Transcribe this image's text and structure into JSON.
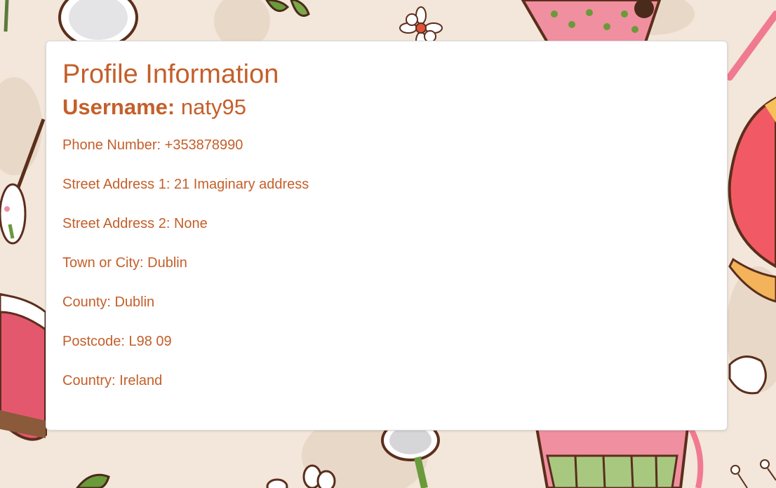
{
  "profile": {
    "title": "Profile Information",
    "username_label": "Username:",
    "username_value": "naty95",
    "fields": [
      "Phone Number: +353878990",
      "Street Address 1: 21 Imaginary address",
      "Street Address 2: None",
      "Town or City: Dublin",
      "County: Dublin",
      "Postcode: L98 09",
      "Country: Ireland"
    ]
  },
  "colors": {
    "accent": "#c45f2a",
    "background": "#f3e6da",
    "card": "#ffffff"
  }
}
